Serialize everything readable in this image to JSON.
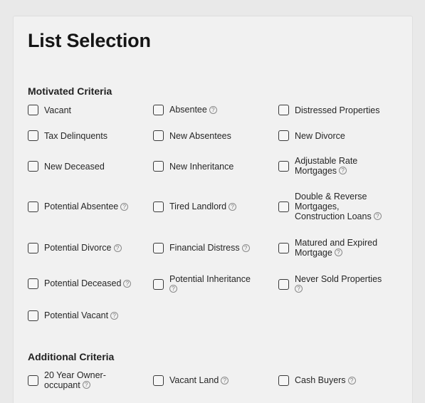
{
  "title": "List Selection",
  "help_glyph": "?",
  "motivated": {
    "heading": "Motivated Criteria",
    "items": [
      {
        "label": "Vacant"
      },
      {
        "label": "Absentee"
      },
      {
        "label": "Distressed Properties"
      },
      {
        "label": "Tax Delinquents"
      },
      {
        "label": "New Absentees"
      },
      {
        "label": "New Divorce"
      },
      {
        "label": "New Deceased"
      },
      {
        "label": "New Inheritance"
      },
      {
        "label_line1": "Adjustable Rate",
        "label_line2": "Mortgages"
      },
      {
        "label": "Potential Absentee"
      },
      {
        "label": "Tired Landlord"
      },
      {
        "label_line1": "Double & Reverse",
        "label_line2": "Mortgages,",
        "label_line3": "Construction Loans"
      },
      {
        "label": "Potential Divorce"
      },
      {
        "label": "Financial Distress"
      },
      {
        "label_line1": "Matured and Expired",
        "label_line2": "Mortgage"
      },
      {
        "label": "Potential Deceased"
      },
      {
        "label_line1": "Potential Inheritance"
      },
      {
        "label": "Never Sold Properties"
      },
      {
        "label": "Potential Vacant"
      }
    ]
  },
  "additional": {
    "heading": "Additional Criteria",
    "items": [
      {
        "label_line1": "20 Year Owner-",
        "label_line2": "occupant"
      },
      {
        "label": "Vacant Land"
      },
      {
        "label": "Cash Buyers"
      }
    ]
  }
}
